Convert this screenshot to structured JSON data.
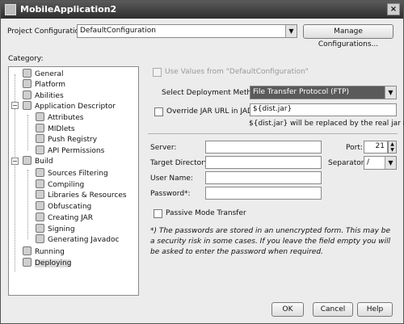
{
  "window": {
    "title": "MobileApplication2",
    "close_glyph": "×"
  },
  "project_config": {
    "label": "Project Configuration:",
    "value": "DefaultConfiguration",
    "manage_button": "Manage Configurations..."
  },
  "category": {
    "label": "Category:",
    "items": [
      {
        "label": "General",
        "icon": "gear-icon"
      },
      {
        "label": "Platform",
        "icon": "platform-icon"
      },
      {
        "label": "Abilities",
        "icon": "abilities-icon"
      },
      {
        "label": "Application Descriptor",
        "icon": "descriptor-icon"
      },
      {
        "label": "Attributes",
        "icon": "document-icon"
      },
      {
        "label": "MIDlets",
        "icon": "document-icon"
      },
      {
        "label": "Push Registry",
        "icon": "document-icon"
      },
      {
        "label": "API Permissions",
        "icon": "document-icon"
      },
      {
        "label": "Build",
        "icon": "build-icon"
      },
      {
        "label": "Sources Filtering",
        "icon": "filter-icon"
      },
      {
        "label": "Compiling",
        "icon": "compile-icon"
      },
      {
        "label": "Libraries & Resources",
        "icon": "library-icon"
      },
      {
        "label": "Obfuscating",
        "icon": "obfuscate-icon"
      },
      {
        "label": "Creating JAR",
        "icon": "jar-icon"
      },
      {
        "label": "Signing",
        "icon": "signing-icon"
      },
      {
        "label": "Generating Javadoc",
        "icon": "javadoc-icon"
      },
      {
        "label": "Running",
        "icon": "run-icon"
      },
      {
        "label": "Deploying",
        "icon": "deploy-icon"
      }
    ],
    "expander_glyph": "−"
  },
  "deploy": {
    "use_values_label": "Use Values from \"DefaultConfiguration\"",
    "method_label": "Select Deployment Method:",
    "method_value": "File Transfer Protocol (FTP)",
    "override_jar_label": "Override JAR URL in JAD:",
    "jar_url_value": "${dist.jar}",
    "jar_hint": "${dist.jar} will be replaced by the real jar name",
    "server_label": "Server:",
    "server_value": "",
    "port_label": "Port:",
    "port_value": "21",
    "target_dir_label": "Target Directory:",
    "target_dir_value": "",
    "separator_label": "Separator:",
    "separator_value": "/",
    "user_name_label": "User Name:",
    "user_name_value": "",
    "password_label": "Password*:",
    "password_value": "",
    "passive_mode_label": "Passive Mode Transfer",
    "note": "*) The passwords are stored in an unencrypted form. This may be a security risk in some cases. If you leave the field empty you will be asked to enter the password when required."
  },
  "buttons": {
    "ok": "OK",
    "cancel": "Cancel",
    "help": "Help"
  },
  "glyphs": {
    "combo_arrow": "▼",
    "spin_up": "▲",
    "spin_down": "▼"
  }
}
